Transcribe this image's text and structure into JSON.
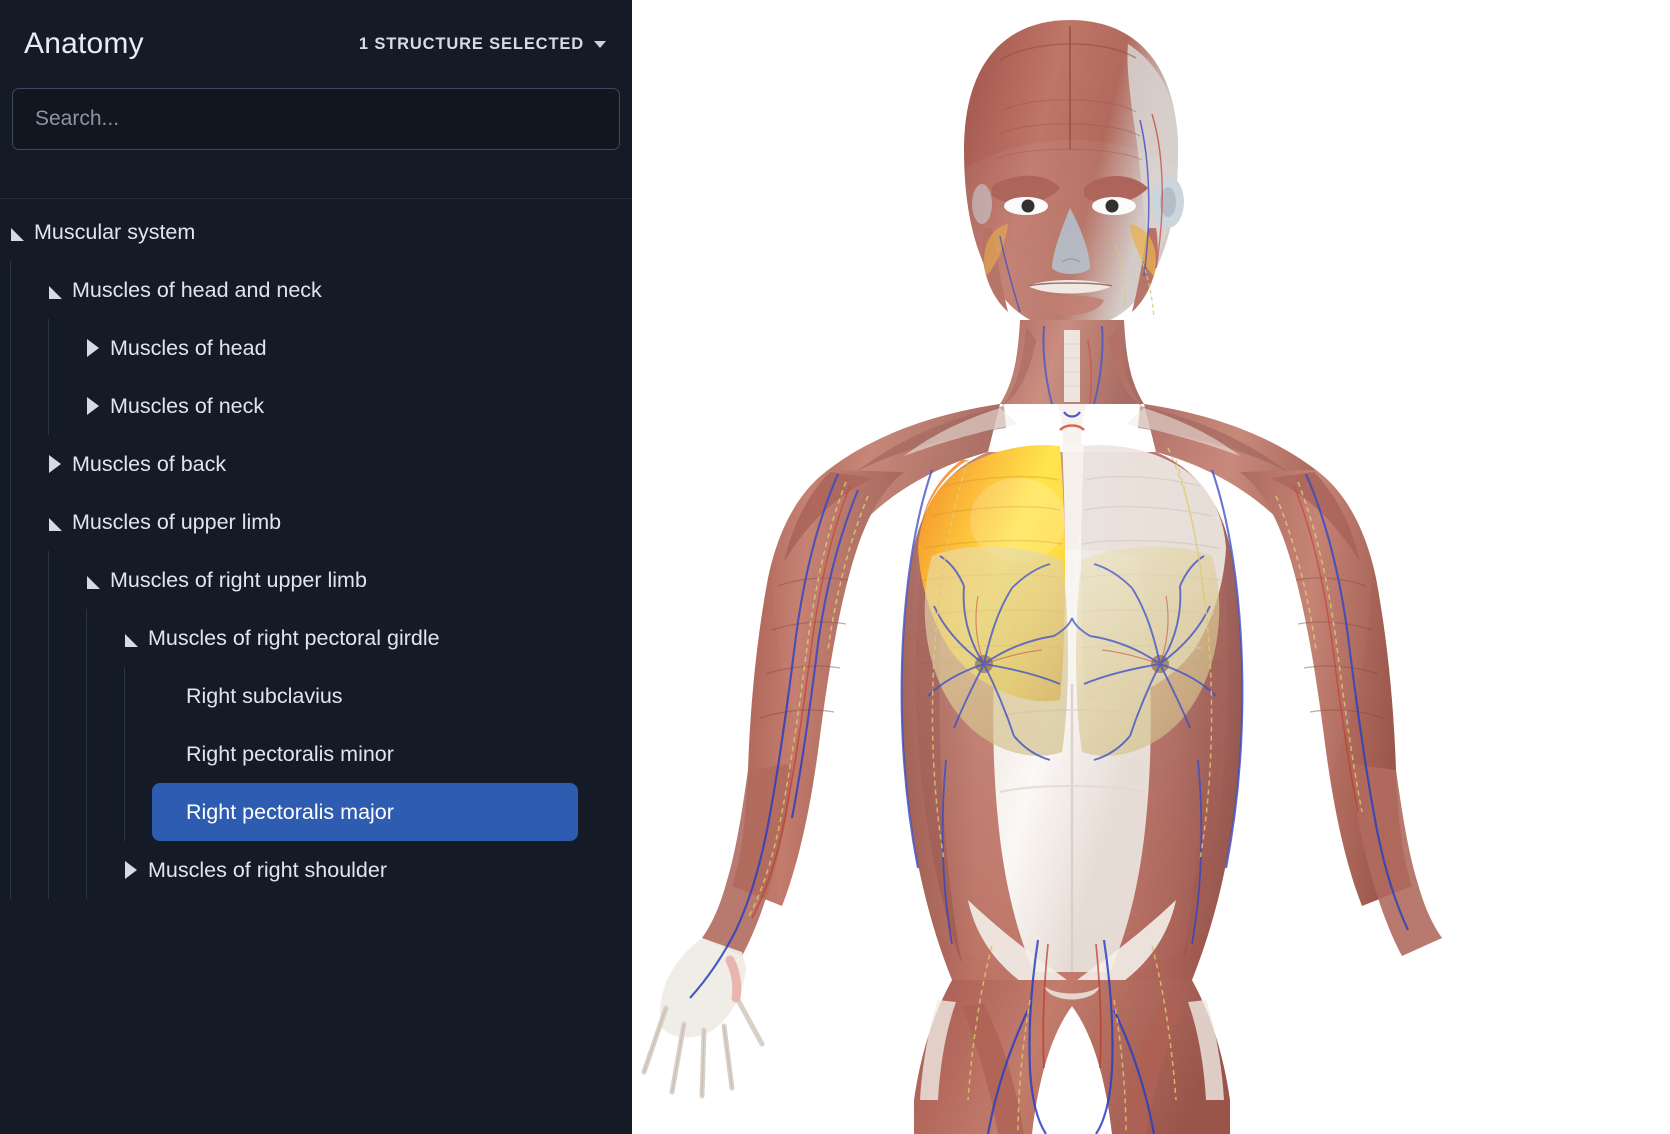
{
  "app": {
    "title": "Anatomy"
  },
  "header": {
    "selection_label": "1 STRUCTURE SELECTED",
    "caret_icon": "chevron-down-icon"
  },
  "search": {
    "value": "",
    "placeholder": "Search..."
  },
  "colors": {
    "sidebar_bg": "#141A26",
    "search_bg": "#11161F",
    "search_border": "#3B4660",
    "text": "#DFE5EE",
    "selection_blue": "#2D5CB0",
    "guide_line": "#2A3447",
    "viewport_bg": "#FFFFFF",
    "highlight_yellow": "#FFD500",
    "highlight_orange": "#F08A1E",
    "muscle_red": "#B0655A",
    "vein_blue": "#2A3FC0",
    "artery_red": "#C62828",
    "nerve_yellow": "#D9C36A",
    "tendon_white": "#F2EFEA"
  },
  "tree": {
    "nodes": [
      {
        "label": "Muscular system",
        "state": "expanded",
        "depth": 0,
        "selected": false,
        "children": [
          {
            "label": "Muscles of head and neck",
            "state": "expanded",
            "depth": 1,
            "selected": false,
            "children": [
              {
                "label": "Muscles of head",
                "state": "collapsed",
                "depth": 2,
                "selected": false,
                "children": []
              },
              {
                "label": "Muscles of neck",
                "state": "collapsed",
                "depth": 2,
                "selected": false,
                "children": []
              }
            ]
          },
          {
            "label": "Muscles of back",
            "state": "collapsed",
            "depth": 1,
            "selected": false,
            "children": []
          },
          {
            "label": "Muscles of upper limb",
            "state": "expanded",
            "depth": 1,
            "selected": false,
            "children": [
              {
                "label": "Muscles of right upper limb",
                "state": "expanded",
                "depth": 2,
                "selected": false,
                "children": [
                  {
                    "label": "Muscles of right pectoral girdle",
                    "state": "expanded",
                    "depth": 3,
                    "selected": false,
                    "children": [
                      {
                        "label": "Right subclavius",
                        "state": "leaf",
                        "depth": 4,
                        "selected": false,
                        "children": []
                      },
                      {
                        "label": "Right pectoralis minor",
                        "state": "leaf",
                        "depth": 4,
                        "selected": false,
                        "children": []
                      },
                      {
                        "label": "Right pectoralis major",
                        "state": "leaf",
                        "depth": 4,
                        "selected": true,
                        "children": []
                      }
                    ]
                  },
                  {
                    "label": "Muscles of right shoulder",
                    "state": "collapsed",
                    "depth": 3,
                    "selected": false,
                    "children": []
                  }
                ]
              }
            ]
          }
        ]
      }
    ]
  },
  "viewport": {
    "name": "3d-anatomy-model",
    "view": "anterior full-body muscular system, female",
    "highlighted_structure": "Right pectoralis major",
    "highlight_color": "#FFD500",
    "background": "#FFFFFF"
  }
}
